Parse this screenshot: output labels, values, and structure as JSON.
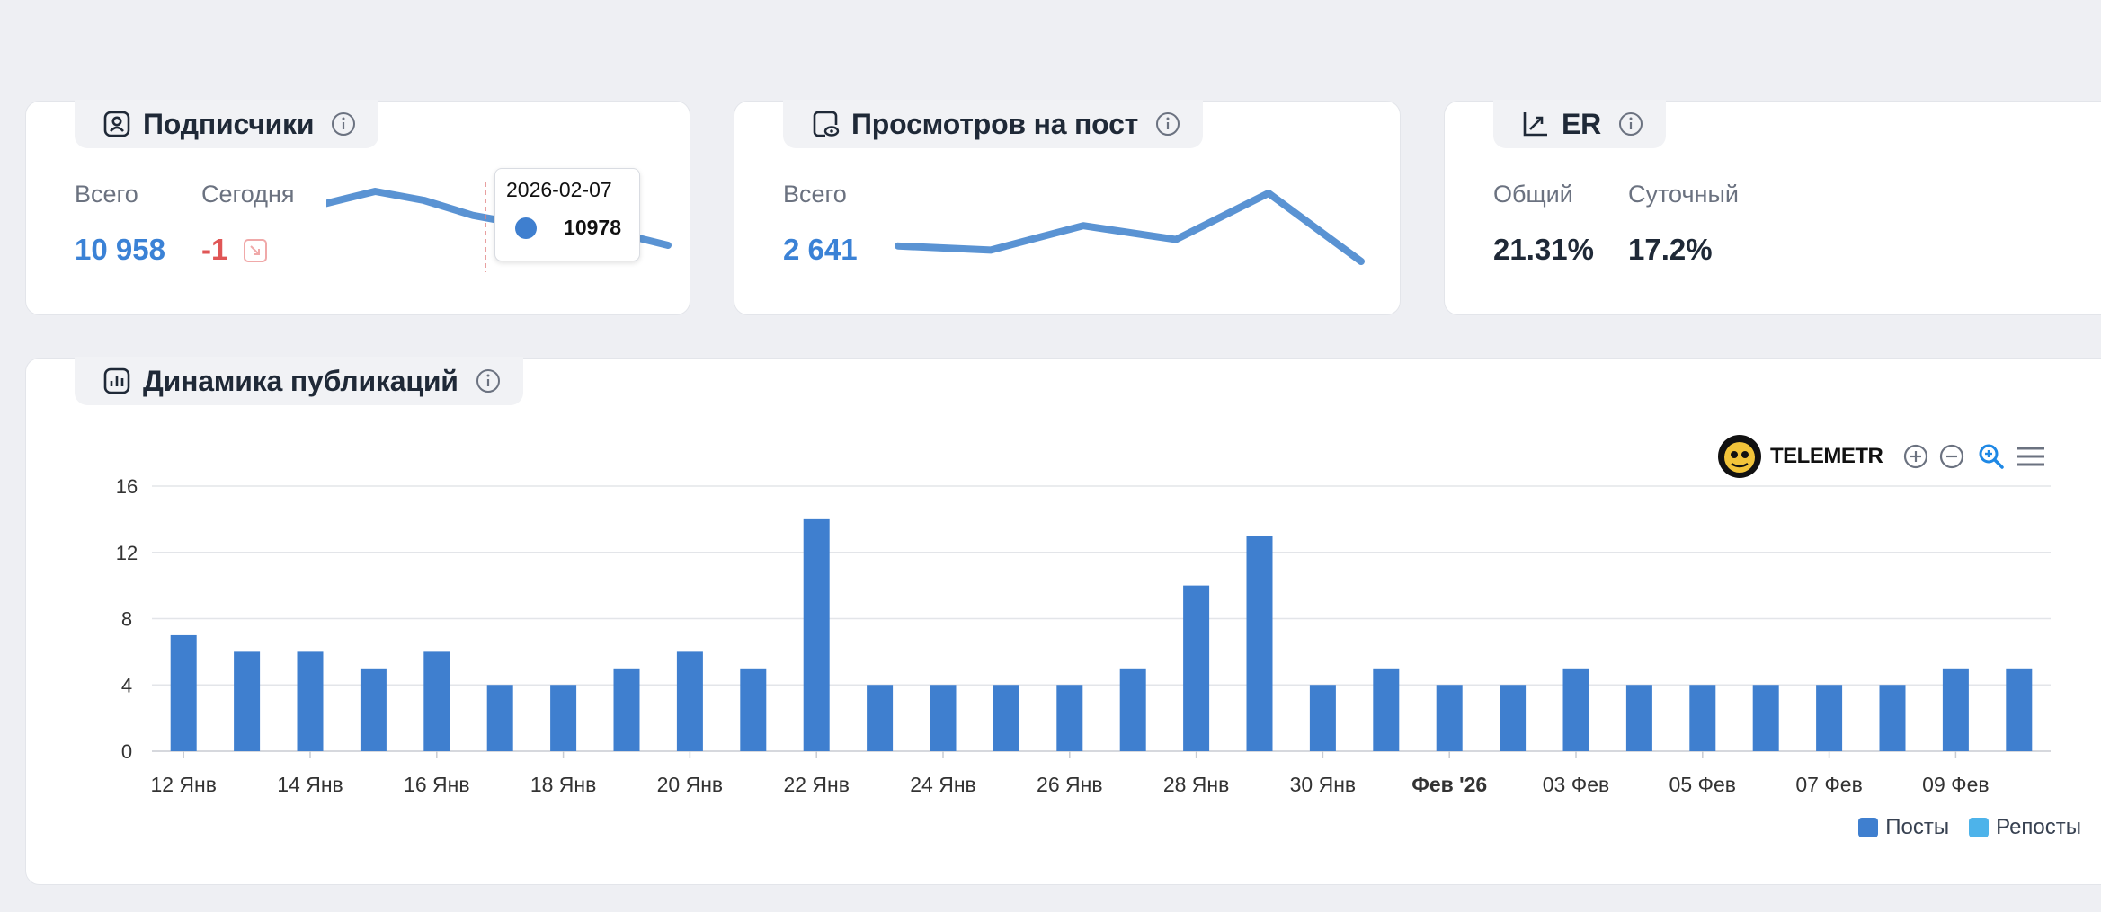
{
  "subscribers": {
    "title": "Подписчики",
    "total_label": "Всего",
    "total_value": "10 958",
    "today_label": "Сегодня",
    "today_value": "-1",
    "tooltip": {
      "date": "2026-02-07",
      "value": "10978"
    }
  },
  "views": {
    "title": "Просмотров на пост",
    "total_label": "Всего",
    "total_value": "2 641"
  },
  "er": {
    "title": "ER",
    "overall_label": "Общий",
    "overall_value": "21.31%",
    "daily_label": "Суточный",
    "daily_value": "17.2%"
  },
  "publications": {
    "title": "Динамика публикаций",
    "brand": "TELEMETR",
    "toolbar": [
      "zoom-in-icon",
      "zoom-out-icon",
      "zoom-select-icon",
      "menu-icon"
    ]
  },
  "colors": {
    "accent": "#3b82d6",
    "posts": "#3f7fcf",
    "reposts": "#4db3ea",
    "negative": "#e05656"
  },
  "chart_data": {
    "type": "bar",
    "categories": [
      "12 Янв",
      "13 Янв",
      "14 Янв",
      "15 Янв",
      "16 Янв",
      "17 Янв",
      "18 Янв",
      "19 Янв",
      "20 Янв",
      "21 Янв",
      "22 Янв",
      "23 Янв",
      "24 Янв",
      "25 Янв",
      "26 Янв",
      "27 Янв",
      "28 Янв",
      "29 Янв",
      "30 Янв",
      "31 Янв",
      "Фев '26",
      "02 Фев",
      "03 Фев",
      "04 Фев",
      "05 Фев",
      "06 Фев",
      "07 Фев",
      "08 Фев",
      "09 Фев",
      "10 Фев"
    ],
    "tick_labels": [
      "12 Янв",
      "14 Янв",
      "16 Янв",
      "18 Янв",
      "20 Янв",
      "22 Янв",
      "24 Янв",
      "26 Янв",
      "28 Янв",
      "30 Янв",
      "Фев '26",
      "03 Фев",
      "05 Фев",
      "07 Фев",
      "09 Фев"
    ],
    "series": [
      {
        "name": "Посты",
        "values": [
          7,
          6,
          6,
          5,
          6,
          4,
          4,
          5,
          6,
          5,
          14,
          4,
          4,
          4,
          4,
          5,
          10,
          13,
          4,
          5,
          4,
          4,
          5,
          4,
          4,
          4,
          4,
          4,
          5,
          5
        ]
      },
      {
        "name": "Репосты",
        "values": [
          0,
          0,
          0,
          0,
          0,
          0,
          0,
          0,
          0,
          0,
          0,
          0,
          0,
          0,
          0,
          0,
          0,
          0,
          0,
          0,
          0,
          0,
          0,
          0,
          0,
          0,
          0,
          0,
          0,
          0
        ]
      }
    ],
    "yticks": [
      0,
      4,
      8,
      12,
      16
    ],
    "ylim": [
      0,
      16
    ],
    "grid": true,
    "legend_position": "bottom-right"
  },
  "sparklines": {
    "subscribers": [
      10985,
      10989,
      10986,
      10981,
      10978,
      10976,
      10975,
      10971
    ],
    "views": [
      2660,
      2655,
      2685,
      2668,
      2725,
      2641
    ]
  }
}
